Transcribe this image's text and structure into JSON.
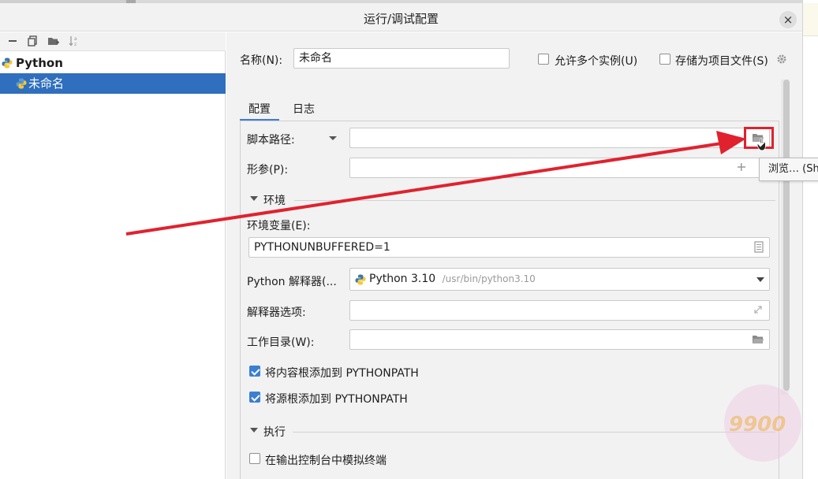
{
  "window": {
    "title": "运行/调试配置",
    "close_glyph": "×"
  },
  "left_toolbar": {
    "icons": [
      "minus-icon",
      "copy-icon",
      "folder-add-icon",
      "sort-icon"
    ]
  },
  "tree": {
    "group_label": "Python",
    "item_label": "未命名"
  },
  "form": {
    "name_label": "名称(N):",
    "name_value": "未命名",
    "allow_parallel_label": "允许多个实例(U)",
    "store_as_project_label": "存储为项目文件(S)",
    "tabs": [
      {
        "label": "配置",
        "active": true
      },
      {
        "label": "日志",
        "active": false
      }
    ],
    "script_path_label": "脚本路径:",
    "script_path_value": "",
    "params_label": "形参(P):",
    "params_value": "",
    "env_section": "环境",
    "env_vars_label": "环境变量(E):",
    "env_vars_value": "PYTHONUNBUFFERED=1",
    "interpreter_label": "Python 解释器(...",
    "interpreter_name": "Python 3.10",
    "interpreter_path": "/usr/bin/python3.10",
    "interp_options_label": "解释器选项:",
    "interp_options_value": "",
    "workdir_label": "工作目录(W):",
    "workdir_value": "",
    "add_content_roots_label": "将内容根添加到 PYTHONPATH",
    "add_content_roots_checked": true,
    "add_source_roots_label": "将源根添加到 PYTHONPATH",
    "add_source_roots_checked": true,
    "exec_section": "执行",
    "emulate_terminal_label": "在输出控制台中模拟终端",
    "emulate_terminal_checked": false,
    "allow_parallel_checked": false,
    "store_as_project_checked": false
  },
  "tooltip": {
    "text": "浏览… (Shi"
  },
  "watermark": {
    "text": "9900"
  },
  "colors": {
    "accent": "#3d7fd1",
    "selection": "#2f6fbd",
    "annotation_red": "#e0222e",
    "python_blue": "#3b77a8",
    "python_yellow": "#f6c933"
  }
}
